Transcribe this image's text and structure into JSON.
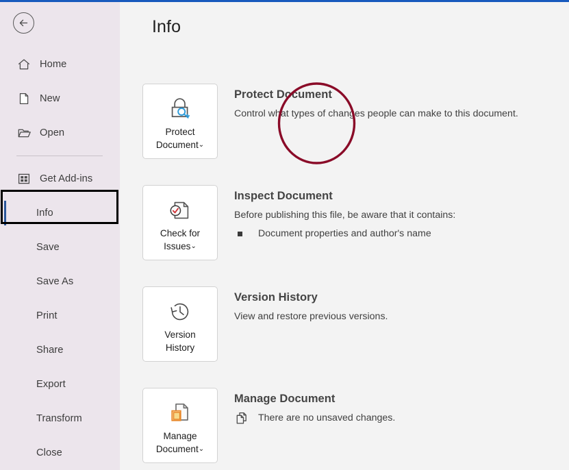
{
  "window": {
    "accent_color": "#185abd",
    "sidebar_bg": "#ece5ec",
    "main_bg": "#f3f3f3"
  },
  "sidebar": {
    "back_button": {
      "label": "Back",
      "icon": "arrow-left-circle-icon"
    },
    "items": [
      {
        "label": "Home",
        "icon": "home-icon",
        "selected": false,
        "has_icon": true
      },
      {
        "label": "New",
        "icon": "new-page-icon",
        "selected": false,
        "has_icon": true
      },
      {
        "label": "Open",
        "icon": "folder-icon",
        "selected": false,
        "has_icon": true
      },
      {
        "label": "Get Add-ins",
        "icon": "grid-addins-icon",
        "selected": false,
        "has_icon": true
      },
      {
        "label": "Info",
        "icon": "",
        "selected": true,
        "has_icon": false
      },
      {
        "label": "Save",
        "icon": "",
        "selected": false,
        "has_icon": false
      },
      {
        "label": "Save As",
        "icon": "",
        "selected": false,
        "has_icon": false
      },
      {
        "label": "Print",
        "icon": "",
        "selected": false,
        "has_icon": false
      },
      {
        "label": "Share",
        "icon": "",
        "selected": false,
        "has_icon": false
      },
      {
        "label": "Export",
        "icon": "",
        "selected": false,
        "has_icon": false
      },
      {
        "label": "Transform",
        "icon": "",
        "selected": false,
        "has_icon": false
      },
      {
        "label": "Close",
        "icon": "",
        "selected": false,
        "has_icon": false
      }
    ],
    "selected_accent_color": "#2b579a"
  },
  "main": {
    "title": "Info",
    "sections": {
      "protect": {
        "tile_label_line1": "Protect",
        "tile_label_line2": "Document",
        "tile_chevron": "⌄",
        "tile_icon": "lock-key-icon",
        "heading": "Protect Document",
        "description": "Control what types of changes people can make to this document."
      },
      "inspect": {
        "tile_label_line1": "Check for",
        "tile_label_line2": "Issues",
        "tile_chevron": "⌄",
        "tile_icon": "document-check-icon",
        "heading": "Inspect Document",
        "description": "Before publishing this file, be aware that it contains:",
        "bullets": [
          "Document properties and author's name"
        ]
      },
      "version": {
        "tile_label_line1": "Version",
        "tile_label_line2": "History",
        "tile_chevron": "",
        "tile_icon": "clock-back-icon",
        "heading": "Version History",
        "description": "View and restore previous versions."
      },
      "manage": {
        "tile_label_line1": "Manage",
        "tile_label_line2": "Document",
        "tile_chevron": "⌄",
        "tile_icon": "document-copy-orange-icon",
        "heading": "Manage Document",
        "status_icon": "documents-stack-icon",
        "status_text": "There are no unsaved changes."
      }
    }
  },
  "annotations": {
    "circle_color": "#8a0b28",
    "circle_target": "protect-document-tile",
    "rect_color": "#000000",
    "rect_target": "sidebar-item-info"
  }
}
